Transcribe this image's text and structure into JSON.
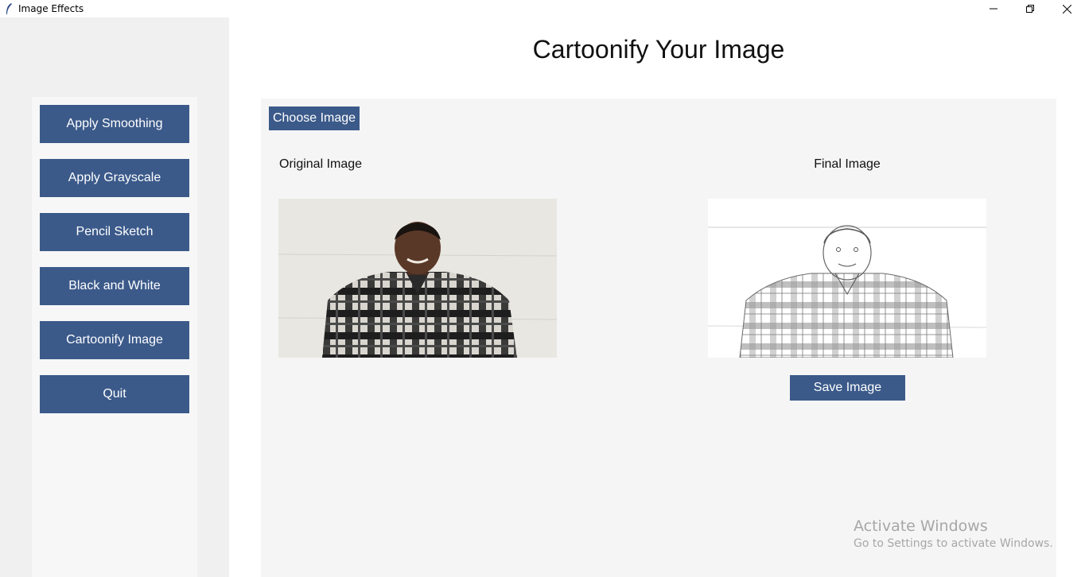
{
  "window": {
    "title": "Image Effects",
    "icon": "feather-icon",
    "controls": [
      "minimize-icon",
      "restore-icon",
      "close-icon"
    ]
  },
  "sidebar": {
    "buttons": [
      {
        "label": "Apply Smoothing"
      },
      {
        "label": "Apply Grayscale"
      },
      {
        "label": "Pencil Sketch"
      },
      {
        "label": "Black and White"
      },
      {
        "label": "Cartoonify Image"
      },
      {
        "label": "Quit"
      }
    ]
  },
  "main": {
    "title": "Cartoonify Your Image",
    "choose_button": "Choose Image",
    "original_label": "Original Image",
    "final_label": "Final Image",
    "save_button": "Save Image"
  },
  "watermark": {
    "line1": "Activate Windows",
    "line2": "Go to Settings to activate Windows."
  },
  "colors": {
    "button_bg": "#3b5a8a",
    "button_text": "#ffffff",
    "sidebar_bg": "#f0f0f0",
    "panel_bg": "#f5f5f5"
  }
}
